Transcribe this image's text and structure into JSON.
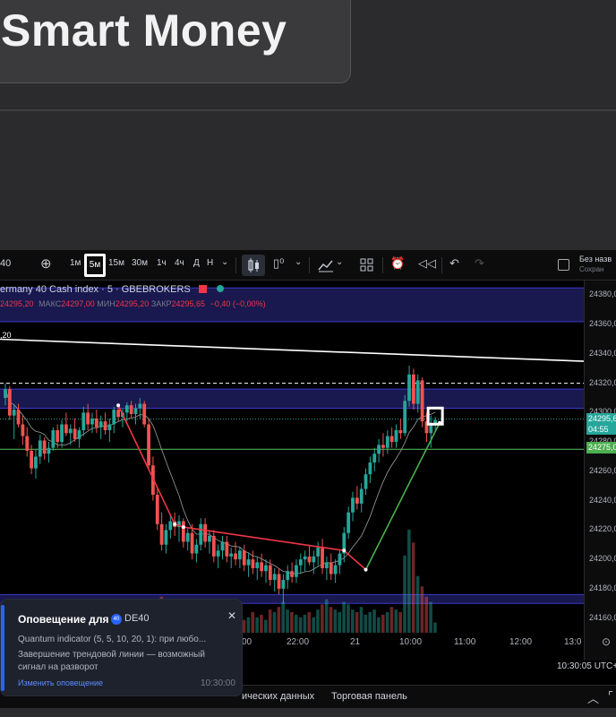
{
  "banner": {
    "title": "Smart Money"
  },
  "toolbar": {
    "symbol": "40",
    "intervals": [
      "1м",
      "5м",
      "15м",
      "30м",
      "1ч",
      "4ч",
      "Д",
      "Н"
    ],
    "active_interval": "5м",
    "right_label": "Без назв",
    "right_sublabel": "Сохран"
  },
  "legend": {
    "title": "ermany 40 Cash index · 5 · GBEBROKERS",
    "ohlc_open": "24295,20",
    "ohlc_high_label": "МАКС",
    "ohlc_high": "24297,00",
    "ohlc_low_label": "МИН",
    "ohlc_low": "24295,20",
    "ohlc_close_label": "ЗАКР",
    "ohlc_close": "24295,65",
    "change": "−0,40 (−0,00%)",
    "line_value": ",20"
  },
  "price_axis": {
    "ticks": [
      "24380,0",
      "24360,0",
      "24340,0",
      "24320,0",
      "24300,0",
      "24280,0",
      "24260,0",
      "24240,0",
      "24220,0",
      "24200,0",
      "24180,0",
      "24160,0"
    ],
    "current_price": "24295,6",
    "countdown": "04:55",
    "green_level": "24275,0"
  },
  "time_axis": {
    "ticks": [
      "00",
      "22:00",
      "21",
      "10:00",
      "11:00",
      "12:00",
      "13:0"
    ]
  },
  "status": {
    "clock": "10:30:05 UTC+"
  },
  "bottom_bar": {
    "items": [
      "ических данных",
      "Торговая панель"
    ]
  },
  "notification": {
    "title": "Оповещение для",
    "badge": "40",
    "symbol": "DE40",
    "line1": "Quantum indicator (5, 5, 10, 20, 1): при любо...",
    "line2": "Завершение трендовой линии — возможный",
    "line3": "сигнал на разворот",
    "link": "Изменить оповещение",
    "time": "10:30:00"
  },
  "colors": {
    "bull": "#26a69a",
    "bear": "#ef5350",
    "trend": "#f23645",
    "level_green": "#4caf50",
    "band_blue": "#2d2b8f",
    "accent": "#2962ff"
  },
  "chart_data": {
    "type": "candlestick",
    "title": "ermany 40 Cash index · 5 · GBEBROKERS",
    "ylim": [
      24150,
      24390
    ],
    "y_ticks": [
      24380,
      24360,
      24340,
      24320,
      24300,
      24280,
      24260,
      24240,
      24220,
      24200,
      24180,
      24160
    ],
    "x_ticks": [
      "00",
      "22:00",
      "21",
      "10:00",
      "11:00",
      "12:00",
      "13:0"
    ],
    "horizontal_levels": [
      {
        "value": 24320,
        "style": "dashed",
        "color": "#ffffff"
      },
      {
        "value": 24295.6,
        "style": "dotted",
        "color": "#26a69a"
      },
      {
        "value": 24275,
        "style": "solid",
        "color": "#4caf50"
      }
    ],
    "zones": [
      {
        "from": 24362,
        "to": 24385,
        "color": "#2d2b8f"
      },
      {
        "from": 24303,
        "to": 24316,
        "color": "#2d2b8f"
      },
      {
        "from": 24170,
        "to": 24176,
        "color": "#2d2b8f"
      }
    ],
    "descending_line": {
      "start_value": 24350,
      "end_value": 24335
    },
    "trend_points": [
      {
        "i": 26,
        "v": 24305
      },
      {
        "i": 39,
        "v": 24224
      },
      {
        "i": 41,
        "v": 24222
      },
      {
        "i": 78,
        "v": 24206
      },
      {
        "i": 83,
        "v": 24193
      },
      {
        "i": 100,
        "v": 24293
      }
    ],
    "candles": [
      [
        24310,
        24320,
        24305,
        24316
      ],
      [
        24316,
        24318,
        24295,
        24298
      ],
      [
        24298,
        24305,
        24282,
        24302
      ],
      [
        24302,
        24306,
        24290,
        24292
      ],
      [
        24292,
        24298,
        24278,
        24284
      ],
      [
        24284,
        24290,
        24270,
        24274
      ],
      [
        24274,
        24278,
        24258,
        24262
      ],
      [
        24262,
        24275,
        24255,
        24270
      ],
      [
        24270,
        24285,
        24265,
        24281
      ],
      [
        24281,
        24283,
        24268,
        24272
      ],
      [
        24272,
        24280,
        24266,
        24276
      ],
      [
        24276,
        24290,
        24274,
        24288
      ],
      [
        24288,
        24292,
        24276,
        24280
      ],
      [
        24280,
        24295,
        24276,
        24292
      ],
      [
        24292,
        24300,
        24284,
        24286
      ],
      [
        24286,
        24292,
        24278,
        24289
      ],
      [
        24289,
        24296,
        24280,
        24282
      ],
      [
        24282,
        24290,
        24276,
        24288
      ],
      [
        24288,
        24304,
        24284,
        24300
      ],
      [
        24300,
        24306,
        24288,
        24292
      ],
      [
        24292,
        24300,
        24286,
        24296
      ],
      [
        24296,
        24302,
        24286,
        24290
      ],
      [
        24290,
        24298,
        24282,
        24294
      ],
      [
        24294,
        24300,
        24285,
        24288
      ],
      [
        24288,
        24296,
        24280,
        24292
      ],
      [
        24292,
        24304,
        24286,
        24302
      ],
      [
        24302,
        24306,
        24294,
        24297
      ],
      [
        24297,
        24303,
        24290,
        24300
      ],
      [
        24300,
        24307,
        24294,
        24305
      ],
      [
        24305,
        24308,
        24296,
        24299
      ],
      [
        24299,
        24306,
        24292,
        24303
      ],
      [
        24303,
        24310,
        24296,
        24306
      ],
      [
        24306,
        24308,
        24290,
        24292
      ],
      [
        24292,
        24296,
        24262,
        24264
      ],
      [
        24264,
        24270,
        24240,
        24244
      ],
      [
        24244,
        24250,
        24220,
        24224
      ],
      [
        24224,
        24232,
        24206,
        24210
      ],
      [
        24210,
        24224,
        24204,
        24220
      ],
      [
        24220,
        24230,
        24214,
        24226
      ],
      [
        24226,
        24232,
        24216,
        24222
      ],
      [
        24222,
        24230,
        24212,
        24226
      ],
      [
        24226,
        24228,
        24208,
        24212
      ],
      [
        24212,
        24222,
        24206,
        24218
      ],
      [
        24218,
        24224,
        24200,
        24204
      ],
      [
        24204,
        24214,
        24198,
        24210
      ],
      [
        24210,
        24228,
        24206,
        24224
      ],
      [
        24224,
        24228,
        24208,
        24212
      ],
      [
        24212,
        24220,
        24204,
        24216
      ],
      [
        24216,
        24220,
        24198,
        24202
      ],
      [
        24202,
        24210,
        24194,
        24206
      ],
      [
        24206,
        24216,
        24200,
        24212
      ],
      [
        24212,
        24216,
        24198,
        24202
      ],
      [
        24202,
        24208,
        24194,
        24204
      ],
      [
        24204,
        24212,
        24196,
        24200
      ],
      [
        24200,
        24208,
        24194,
        24206
      ],
      [
        24206,
        24210,
        24192,
        24196
      ],
      [
        24196,
        24204,
        24188,
        24200
      ],
      [
        24200,
        24206,
        24190,
        24194
      ],
      [
        24194,
        24202,
        24186,
        24198
      ],
      [
        24198,
        24204,
        24188,
        24192
      ],
      [
        24192,
        24200,
        24184,
        24196
      ],
      [
        24196,
        24200,
        24182,
        24186
      ],
      [
        24186,
        24194,
        24178,
        24190
      ],
      [
        24190,
        24194,
        24176,
        24180
      ],
      [
        24180,
        24190,
        24170,
        24186
      ],
      [
        24186,
        24196,
        24180,
        24192
      ],
      [
        24192,
        24198,
        24184,
        24188
      ],
      [
        24188,
        24200,
        24184,
        24196
      ],
      [
        24196,
        24204,
        24190,
        24200
      ],
      [
        24200,
        24206,
        24192,
        24202
      ],
      [
        24202,
        24210,
        24196,
        24198
      ],
      [
        24198,
        24206,
        24190,
        24202
      ],
      [
        24202,
        24212,
        24196,
        24208
      ],
      [
        24208,
        24214,
        24190,
        24194
      ],
      [
        24194,
        24202,
        24186,
        24198
      ],
      [
        24198,
        24204,
        24186,
        24190
      ],
      [
        24190,
        24200,
        24184,
        24196
      ],
      [
        24196,
        24206,
        24190,
        24204
      ],
      [
        24204,
        24222,
        24198,
        24218
      ],
      [
        24218,
        24236,
        24214,
        24232
      ],
      [
        24232,
        24246,
        24226,
        24242
      ],
      [
        24242,
        24250,
        24234,
        24238
      ],
      [
        24238,
        24252,
        24232,
        24248
      ],
      [
        24248,
        24262,
        24244,
        24258
      ],
      [
        24258,
        24270,
        24252,
        24266
      ],
      [
        24266,
        24276,
        24260,
        24272
      ],
      [
        24272,
        24282,
        24266,
        24278
      ],
      [
        24278,
        24286,
        24270,
        24276
      ],
      [
        24276,
        24288,
        24272,
        24284
      ],
      [
        24284,
        24290,
        24276,
        24280
      ],
      [
        24280,
        24292,
        24276,
        24288
      ],
      [
        24288,
        24296,
        24282,
        24286
      ],
      [
        24286,
        24312,
        24284,
        24308
      ],
      [
        24308,
        24332,
        24304,
        24326
      ],
      [
        24326,
        24330,
        24302,
        24306
      ],
      [
        24306,
        24326,
        24300,
        24322
      ],
      [
        24322,
        24324,
        24290,
        24294
      ],
      [
        24294,
        24300,
        24280,
        24286
      ],
      [
        24286,
        24298,
        24276,
        24292
      ],
      [
        24292,
        24297,
        24288,
        24295
      ]
    ],
    "volumes": [
      4,
      6,
      5,
      7,
      8,
      6,
      9,
      5,
      6,
      7,
      5,
      8,
      6,
      5,
      7,
      6,
      5,
      8,
      6,
      7,
      5,
      6,
      7,
      5,
      6,
      8,
      5,
      6,
      7,
      5,
      6,
      5,
      8,
      10,
      9,
      12,
      14,
      11,
      9,
      10,
      8,
      9,
      7,
      8,
      6,
      7,
      8,
      6,
      7,
      5,
      6,
      7,
      5,
      6,
      7,
      5,
      6,
      8,
      6,
      7,
      5,
      9,
      8,
      10,
      12,
      9,
      8,
      7,
      6,
      7,
      8,
      6,
      9,
      11,
      13,
      10,
      9,
      8,
      12,
      11,
      9,
      8,
      10,
      7,
      8,
      9,
      6,
      7,
      8,
      10,
      9,
      8,
      30,
      40,
      35,
      22,
      18,
      14,
      12,
      4
    ]
  }
}
